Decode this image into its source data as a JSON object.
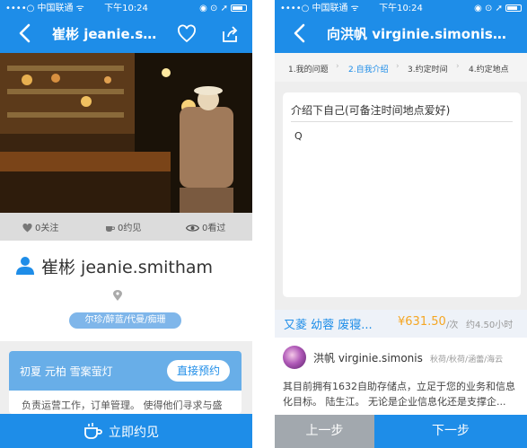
{
  "status_bar": {
    "carrier": "••••○ 中国联通 ᯤ",
    "time": "下午10:24",
    "icons": "◉ ⊙ ➚"
  },
  "profile": {
    "nav_title": "崔彬 jeanie.smit...",
    "stats": {
      "follows": "0关注",
      "meets": "0约见",
      "views": "0看过"
    },
    "name": "崔彬 jeanie.smitham",
    "tag": "尔珍/醉蓝/代曼/痴珊",
    "service": {
      "name": "初夏 元柏 雪案萤灯",
      "book_label": "直接预约",
      "desc": "负责运营工作，订单管理。 使得他们寻求与盛"
    },
    "meet_label": "立即约见"
  },
  "booking": {
    "nav_title": "向洪帆 virginie.simonis的预约",
    "steps": [
      "1.我的问题",
      "2.自我介绍",
      "3.约定时间",
      "4.约定地点"
    ],
    "active_step": 1,
    "intro_title": "介绍下自己(可备注时间地点爱好)",
    "intro_value": "Q",
    "price": {
      "names": "又菱 幼蓉 废寝...",
      "amount": "¥631.50",
      "unit": "/次",
      "duration": "约4.50小时"
    },
    "host": {
      "name": "洪帆 virginie.simonis",
      "tags": "秋荷/秋荷/涵蕾/海云",
      "desc": "其目前拥有1632自助存储点，立足于您的业务和信息化目标。 陆生江。 无论是企业信息化还是支撑企..."
    },
    "prev_label": "上一步",
    "next_label": "下一步"
  },
  "colors": {
    "brand_blue": "#1e8de8",
    "price_orange": "#f5a623",
    "tag_blue": "#7fb6ea"
  },
  "icons": [
    "back-arrow-icon",
    "heart-icon",
    "share-icon",
    "heart-small-icon",
    "cup-icon",
    "eye-icon",
    "person-icon",
    "location-icon",
    "coffee-cup-icon",
    "chevron-right-icon",
    "battery-icon"
  ]
}
